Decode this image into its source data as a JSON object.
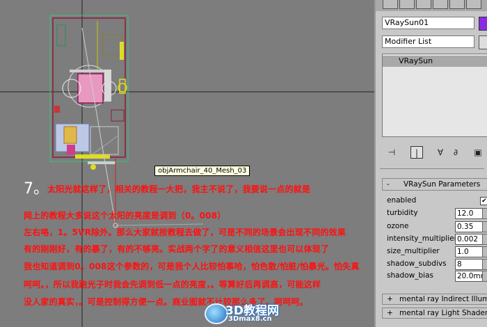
{
  "viewport": {
    "tooltip": "objArmchair_40_Mesh_03",
    "step_number": "7。",
    "notes": [
      "太阳光就这样了，相关的教程一大把，我主不说了，我要说一点的就是",
      "网上的教程大多说这个太阳的亮度是调到（0。008）",
      "左右咯，1。5VR除外。那么大家就按教程去做了，可是不同的场景会出现不同的效果",
      "有的刚刚好，有的暴了，有的不够亮。实战两个字了的意义相信这里也可以体现了",
      "我也知道调到0。008这个参数的，可是我个人比较怕事哈，怕色散/怕脏/怕暴光。怕失真",
      "呵呵。，所以我跑光子时我会先调到低一点的亮度，。等算好后再调高，可能这样",
      "没人家的真实，。可是控制得方便一点。商业图就不计较那么多了。呵呵呵。"
    ]
  },
  "panel": {
    "object_name": "VRaySun01",
    "object_color": "#8a2be2",
    "modifier_list_label": "Modifier List",
    "stack_items": [
      "VRaySun"
    ],
    "stack_tools": [
      {
        "icon": "pin-stack-icon",
        "glyph": "⊣",
        "active": false
      },
      {
        "icon": "show-end-result-icon",
        "glyph": "|",
        "active": true
      },
      {
        "icon": "make-unique-icon",
        "glyph": "∀",
        "active": false
      },
      {
        "icon": "remove-modifier-icon",
        "glyph": "∂",
        "active": false
      },
      {
        "icon": "configure-sets-icon",
        "glyph": "▣",
        "active": false
      }
    ],
    "rollout_title": "VRaySun Parameters",
    "rollout_toggle": "-",
    "params": {
      "enabled_label": "enabled",
      "enabled_checked": "✔",
      "turbidity_label": "turbidity",
      "turbidity_value": "12.0",
      "ozone_label": "ozone",
      "ozone_value": "0.35",
      "intensity_label": "intensity_multiplier",
      "intensity_value": "0.002",
      "size_label": "size_multiplier",
      "size_value": "1.0",
      "subdivs_label": "shadow_subdivs",
      "subdivs_value": "8",
      "bias_label": "shadow_bias",
      "bias_value": "20.0mm"
    },
    "rollouts_collapsed": [
      {
        "toggle": "+",
        "label": "mental ray Indirect Illumination"
      },
      {
        "toggle": "+",
        "label": "mental ray Light Shader"
      }
    ]
  },
  "watermark": {
    "title": "3D教程网",
    "url": "3Dmax8.cn"
  }
}
